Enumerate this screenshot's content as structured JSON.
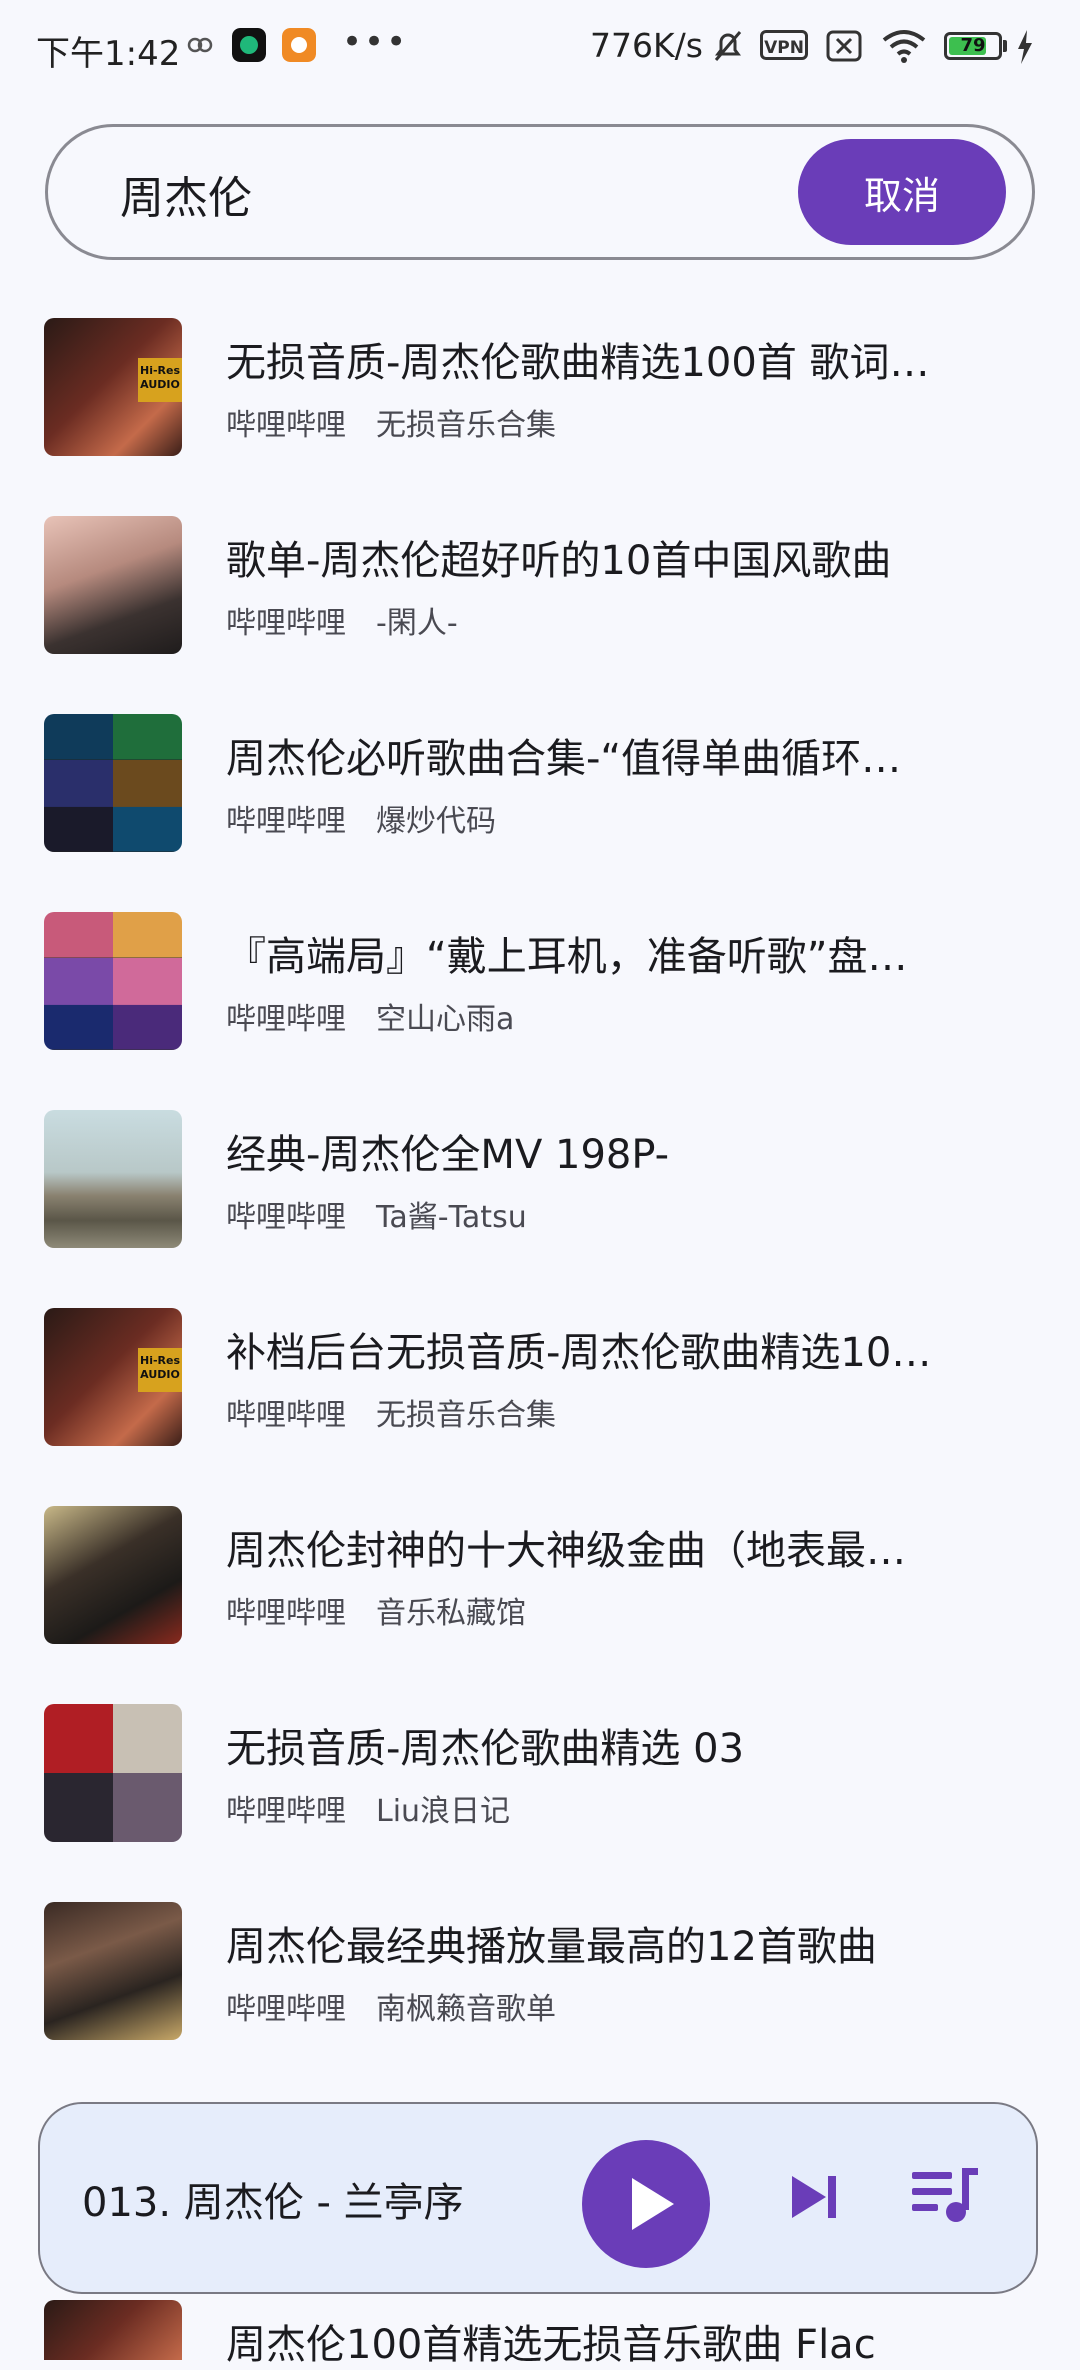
{
  "status_bar": {
    "time": "下午1:42",
    "net_speed": "776K/s",
    "vpn": "VPN",
    "battery": "79",
    "battery_level": 0.79
  },
  "search": {
    "query": "周杰伦",
    "cancel_label": "取消"
  },
  "results": [
    {
      "title": "无损音质-周杰伦歌曲精选100首 歌词…",
      "source": "哔哩哔哩",
      "author": "无损音乐合集",
      "badge": "Hi-Res AUDIO"
    },
    {
      "title": "歌单-周杰伦超好听的10首中国风歌曲",
      "source": "哔哩哔哩",
      "author": "-閑人-"
    },
    {
      "title": "周杰伦必听歌曲合集-“值得单曲循环…",
      "source": "哔哩哔哩",
      "author": "爆炒代码"
    },
    {
      "title": "『高端局』“戴上耳机，准备听歌”盘…",
      "source": "哔哩哔哩",
      "author": "空山心雨a"
    },
    {
      "title": "经典-周杰伦全MV 198P-",
      "source": "哔哩哔哩",
      "author": "Ta酱-Tatsu"
    },
    {
      "title": "补档后台无损音质-周杰伦歌曲精选10…",
      "source": "哔哩哔哩",
      "author": "无损音乐合集",
      "badge": "Hi-Res AUDIO"
    },
    {
      "title": "周杰伦封神的十大神级金曲（地表最…",
      "source": "哔哩哔哩",
      "author": "音乐私藏馆"
    },
    {
      "title": "无损音质-周杰伦歌曲精选 03",
      "source": "哔哩哔哩",
      "author": "Liu浪日记"
    },
    {
      "title": "周杰伦最经典播放量最高的12首歌曲",
      "source": "哔哩哔哩",
      "author": "南枫籁音歌单"
    }
  ],
  "partial_row_title": "周杰伦100首精选无损音乐歌曲 Flac",
  "player": {
    "now_playing": "013. 周杰伦 - 兰亭序"
  },
  "colors": {
    "accent": "#6a3db8",
    "background": "#f7f8fd",
    "player_bg": "#e6edfb"
  }
}
